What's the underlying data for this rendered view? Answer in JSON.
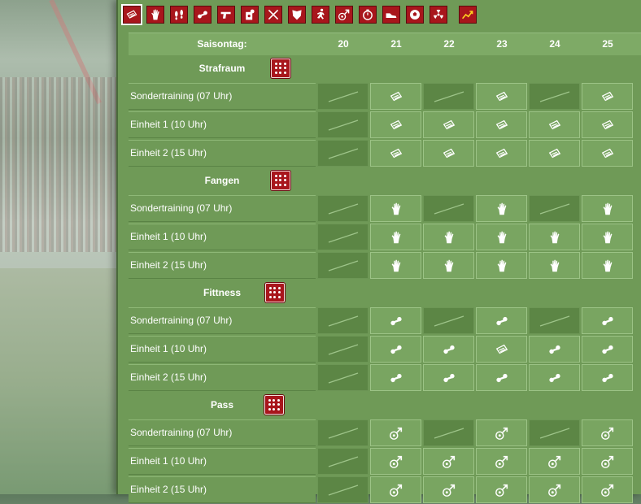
{
  "toolbar": {
    "icons": [
      "strafraum-icon",
      "glove-icon",
      "feet-icon",
      "dumbbell-icon",
      "pistol-icon",
      "target-icon",
      "swords-icon",
      "shield-icon",
      "runner-icon",
      "ball-arrow-icon",
      "stopwatch-icon",
      "shoe-icon",
      "football-icon",
      "radiation-icon",
      "chart-trend-icon"
    ],
    "active_index": 0
  },
  "table": {
    "header_label": "Saisontag:",
    "days": [
      "20",
      "21",
      "22",
      "23",
      "24",
      "25"
    ]
  },
  "sections": [
    {
      "title": "Strafraum",
      "icon": "strafraum",
      "rows": [
        {
          "label": "Sondertraining (07 Uhr)",
          "cells": [
            "none",
            "icon",
            "none",
            "icon",
            "none",
            "icon"
          ]
        },
        {
          "label": "Einheit 1 (10 Uhr)",
          "cells": [
            "none",
            "icon",
            "icon",
            "icon",
            "icon",
            "icon"
          ]
        },
        {
          "label": "Einheit 2 (15 Uhr)",
          "cells": [
            "none",
            "icon",
            "icon",
            "icon",
            "icon",
            "icon"
          ]
        }
      ]
    },
    {
      "title": "Fangen",
      "icon": "glove",
      "rows": [
        {
          "label": "Sondertraining (07 Uhr)",
          "cells": [
            "none",
            "icon",
            "none",
            "icon",
            "none",
            "icon"
          ]
        },
        {
          "label": "Einheit 1 (10 Uhr)",
          "cells": [
            "none",
            "icon",
            "icon",
            "icon",
            "icon",
            "icon"
          ]
        },
        {
          "label": "Einheit 2 (15 Uhr)",
          "cells": [
            "none",
            "icon",
            "icon",
            "icon",
            "icon",
            "icon"
          ]
        }
      ]
    },
    {
      "title": "Fittness",
      "icon": "dumbbell",
      "rows": [
        {
          "label": "Sondertraining (07 Uhr)",
          "cells": [
            "none",
            "icon",
            "none",
            "icon",
            "none",
            "icon"
          ]
        },
        {
          "label": "Einheit 1 (10 Uhr)",
          "cells": [
            "none",
            "icon",
            "icon",
            "strafraum",
            "icon",
            "icon"
          ]
        },
        {
          "label": "Einheit 2 (15 Uhr)",
          "cells": [
            "none",
            "icon",
            "icon",
            "icon",
            "icon",
            "icon"
          ]
        }
      ]
    },
    {
      "title": "Pass",
      "icon": "ballarrow",
      "rows": [
        {
          "label": "Sondertraining (07 Uhr)",
          "cells": [
            "none",
            "icon",
            "none",
            "icon",
            "none",
            "icon"
          ]
        },
        {
          "label": "Einheit 1 (10 Uhr)",
          "cells": [
            "none",
            "icon",
            "icon",
            "icon",
            "icon",
            "icon"
          ]
        },
        {
          "label": "Einheit 2 (15 Uhr)",
          "cells": [
            "none",
            "icon",
            "icon",
            "icon",
            "icon",
            "icon"
          ]
        }
      ]
    }
  ],
  "colors": {
    "accent": "#a8161c",
    "panel": "#6f9a57",
    "cell": "#79a561",
    "cell_dark": "#5c8645"
  }
}
